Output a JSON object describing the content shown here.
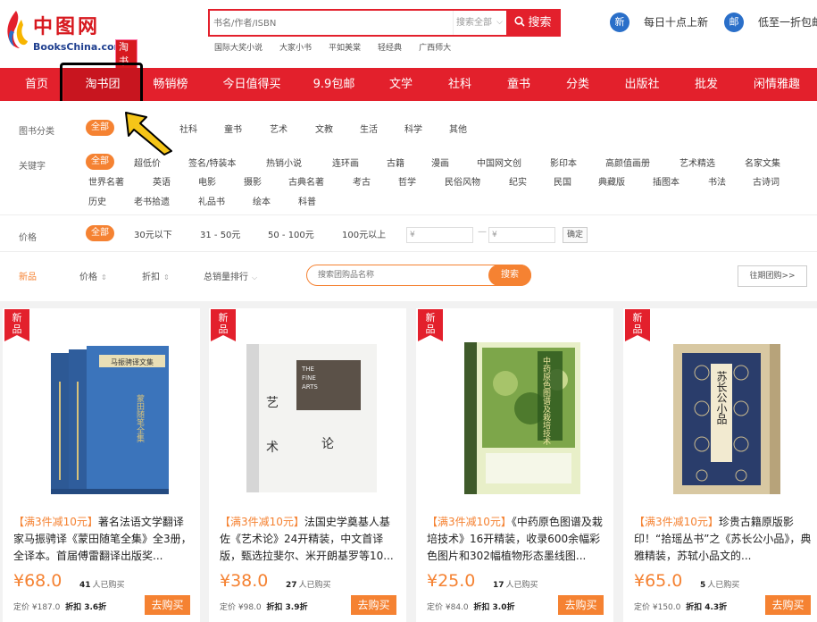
{
  "header": {
    "logo_cn": "中图网",
    "logo_en": "BooksChina.com",
    "logo_badge": "淘书团",
    "search_placeholder": "书名/作者/ISBN",
    "search_scope": "搜索全部",
    "search_button": "搜索",
    "hot_links": [
      "国际大奖小说",
      "大家小书",
      "平如美棠",
      "轻经典",
      "广西师大"
    ],
    "promo1_badge": "新",
    "promo1_text": "每日十点上新",
    "promo2_badge": "邮",
    "promo2_text": "低至一折包邮"
  },
  "nav": {
    "items": [
      "首页",
      "淘书团",
      "畅销榜",
      "今日值得买",
      "9.9包邮",
      "文学",
      "社科",
      "童书",
      "分类",
      "出版社",
      "批发",
      "闲情雅趣"
    ]
  },
  "filters": {
    "category_label": "图书分类",
    "category_items": [
      "全部",
      "社科",
      "童书",
      "艺术",
      "文教",
      "生活",
      "科学",
      "其他"
    ],
    "keyword_label": "关键字",
    "keyword_row1": [
      "全部",
      "超低价",
      "签名/特装本",
      "热销小说",
      "连环画",
      "古籍",
      "漫画",
      "中国网文创",
      "影印本",
      "高颜值画册",
      "艺术精选",
      "名家文集"
    ],
    "keyword_row2": [
      "世界名著",
      "英语",
      "电影",
      "摄影",
      "古典名著",
      "考古",
      "哲学",
      "民俗风物",
      "纪实",
      "民国",
      "典藏版",
      "插图本",
      "书法",
      "古诗词"
    ],
    "keyword_row3": [
      "历史",
      "老书拾遗",
      "礼品书",
      "绘本",
      "科普"
    ],
    "price_label": "价格",
    "price_items": [
      "全部",
      "30元以下",
      "31 - 50元",
      "50 - 100元",
      "100元以上"
    ],
    "price_from": "¥",
    "price_dash": "—",
    "price_to": "¥",
    "price_confirm": "确定"
  },
  "sortbar": {
    "new": "新品",
    "price": "价格",
    "discount": "折扣",
    "sales": "总销量排行",
    "group_search_placeholder": "搜索团购品名称",
    "group_search_button": "搜索",
    "past": "往期团购>>"
  },
  "colors": {
    "brand_red": "#e3202c",
    "accent_orange": "#f58232"
  },
  "products": [
    {
      "tag": "新品",
      "promo": "【满3件减10元】",
      "title": "著名法语文学翻译家马振骋译《蒙田随笔全集》全3册，全译本。首届傅雷翻译出版奖...",
      "price": "¥68.0",
      "buyers": "41",
      "buyers_label": "人已购买",
      "list_price": "定价 ¥187.0",
      "discount": "折扣 3.6折",
      "buy": "去购买"
    },
    {
      "tag": "新品",
      "promo": "【满3件减10元】",
      "title": "法国史学奠基人基佐《艺术论》24开精装，中文首译版，甄选拉斐尔、米开朗基罗等10...",
      "price": "¥38.0",
      "buyers": "27",
      "buyers_label": "人已购买",
      "list_price": "定价 ¥98.0",
      "discount": "折扣 3.9折",
      "buy": "去购买"
    },
    {
      "tag": "新品",
      "promo": "【满3件减10元】",
      "title": "《中药原色图谱及栽培技术》16开精装，收录600余幅彩色图片和302幅植物形态墨线图...",
      "price": "¥25.0",
      "buyers": "17",
      "buyers_label": "人已购买",
      "list_price": "定价 ¥84.0",
      "discount": "折扣 3.0折",
      "buy": "去购买"
    },
    {
      "tag": "新品",
      "promo": "【满3件减10元】",
      "title": "珍贵古籍原版影印！“拾瑶丛书”之《苏长公小品》，典雅精装，苏轼小品文的...",
      "price": "¥65.0",
      "buyers": "5",
      "buyers_label": "人已购买",
      "list_price": "定价 ¥150.0",
      "discount": "折扣 4.3折",
      "buy": "去购买"
    }
  ],
  "covers": {
    "book1_spine": "马振骋译文集",
    "book1_title": "蒙田随笔全集",
    "book2_line1": "THE",
    "book2_line2": "FINE",
    "book2_line3": "ARTS",
    "book2_cn1": "艺",
    "book2_cn2": "术",
    "book2_cn3": "论",
    "book3_title": "中药原色图谱及栽培技术",
    "book4_title": "苏长公小品"
  }
}
